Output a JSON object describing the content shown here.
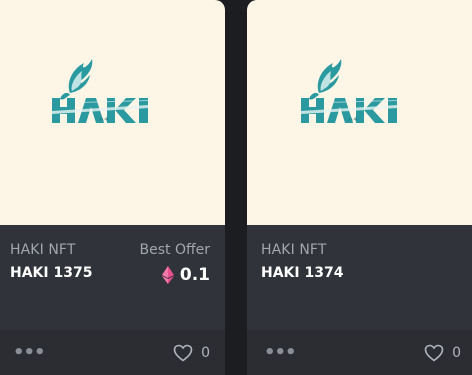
{
  "cards": [
    {
      "collection": "HAKI NFT",
      "name": "HAKI 1375",
      "offer_label": "Best Offer",
      "price": "0.1",
      "currency_icon": "ethereum-icon",
      "likes": "0",
      "more_icon": "more-dots-icon",
      "like_icon": "heart-icon",
      "logo_text": "HAKI"
    },
    {
      "collection": "HAKI NFT",
      "name": "HAKI 1374",
      "likes": "0",
      "more_icon": "more-dots-icon",
      "like_icon": "heart-icon",
      "logo_text": "HAKI"
    }
  ],
  "colors": {
    "card_bg": "#303339",
    "media_bg": "#fdf5e6",
    "logo_teal": "#2a9aa0",
    "eth_pink": "#e8508f"
  }
}
